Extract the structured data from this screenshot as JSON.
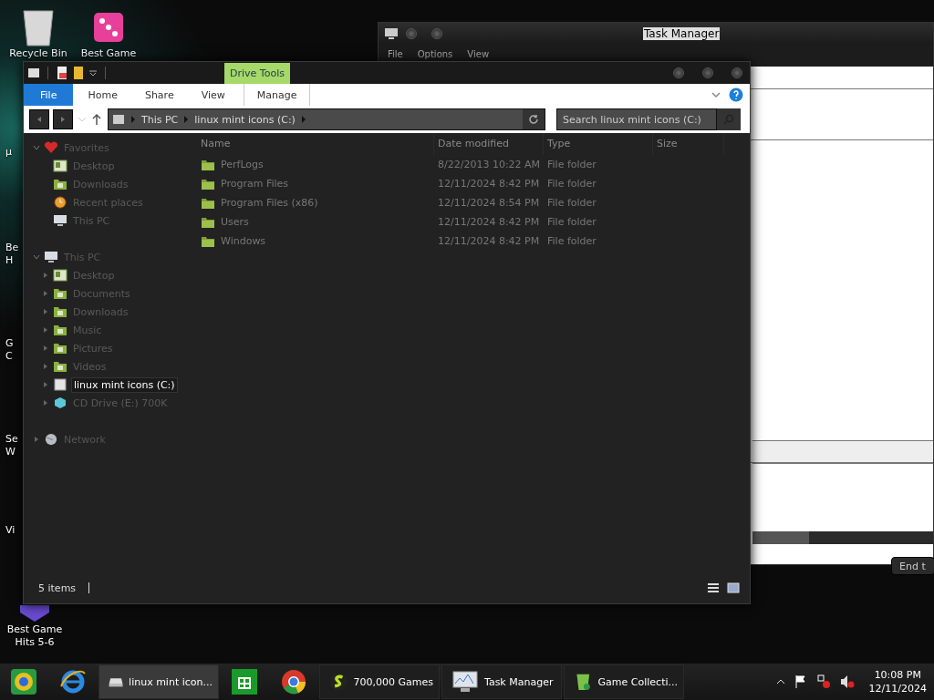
{
  "desktop_icons": [
    {
      "kind": "bin",
      "lines": [
        "Recycle Bin"
      ]
    },
    {
      "kind": "dice",
      "lines": [
        "Best Game"
      ]
    }
  ],
  "desktop_edge_labels": [
    {
      "lines": [
        "µ"
      ]
    },
    {
      "lines": [
        "Be",
        "H"
      ]
    },
    {
      "lines": [
        "G",
        "C"
      ]
    },
    {
      "lines": [
        "Se",
        "W"
      ]
    },
    {
      "lines": [
        "Vi"
      ]
    }
  ],
  "desktop_bottom_icon": {
    "lines": [
      "Best Game",
      "Hits 5-6"
    ]
  },
  "task_manager": {
    "title": "Task Manager",
    "menu": [
      "File",
      "Options",
      "View"
    ],
    "button": "End t"
  },
  "explorer": {
    "context_tab": "Drive Tools",
    "tabs": [
      {
        "label": "File",
        "selected": true
      },
      {
        "label": "Home",
        "selected": false
      },
      {
        "label": "Share",
        "selected": false
      },
      {
        "label": "View",
        "selected": false
      },
      {
        "label": "Manage",
        "selected": false
      }
    ],
    "breadcrumb": [
      "This PC",
      "linux mint icons (C:)"
    ],
    "search": {
      "placeholder": "Search linux mint icons (C:)"
    },
    "nav": [
      {
        "label": "Favorites",
        "expanded": true,
        "children": [
          {
            "label": "Desktop",
            "selected": false
          },
          {
            "label": "Downloads",
            "selected": false
          },
          {
            "label": "Recent places",
            "selected": false
          },
          {
            "label": "This PC",
            "selected": false
          }
        ]
      },
      {
        "label": "This PC",
        "expanded": true,
        "children": [
          {
            "label": "Desktop",
            "selected": false
          },
          {
            "label": "Documents",
            "selected": false
          },
          {
            "label": "Downloads",
            "selected": false
          },
          {
            "label": "Music",
            "selected": false
          },
          {
            "label": "Pictures",
            "selected": false
          },
          {
            "label": "Videos",
            "selected": false
          },
          {
            "label": "linux mint icons (C:)",
            "selected": true
          },
          {
            "label": "CD Drive (E:) 700K",
            "selected": false
          }
        ]
      },
      {
        "label": "Network",
        "expanded": false
      }
    ],
    "columns": [
      "Name",
      "Date modified",
      "Type",
      "Size"
    ],
    "rows": [
      {
        "name": "PerfLogs",
        "date": "8/22/2013 10:22 AM",
        "type": "File folder"
      },
      {
        "name": "Program Files",
        "date": "12/11/2024 8:42 PM",
        "type": "File folder"
      },
      {
        "name": "Program Files (x86)",
        "date": "12/11/2024 8:54 PM",
        "type": "File folder"
      },
      {
        "name": "Users",
        "date": "12/11/2024 8:42 PM",
        "type": "File folder"
      },
      {
        "name": "Windows",
        "date": "12/11/2024 8:42 PM",
        "type": "File folder"
      }
    ],
    "status": "5 items"
  },
  "taskbar": {
    "items": [
      {
        "kind": "chrome-canary",
        "active": false
      },
      {
        "kind": "ie",
        "active": false
      },
      {
        "kind": "drive",
        "label": "linux mint icon...",
        "active": true
      },
      {
        "kind": "store",
        "active": false
      },
      {
        "kind": "chrome",
        "active": false
      },
      {
        "kind": "s-logo",
        "label": "700,000 Games",
        "active": false
      },
      {
        "kind": "monitor",
        "label": "Task Manager",
        "active": false
      },
      {
        "kind": "bin",
        "label": "Game Collecti...",
        "active": false
      }
    ],
    "time": "10:08 PM",
    "date": "12/11/2024"
  }
}
